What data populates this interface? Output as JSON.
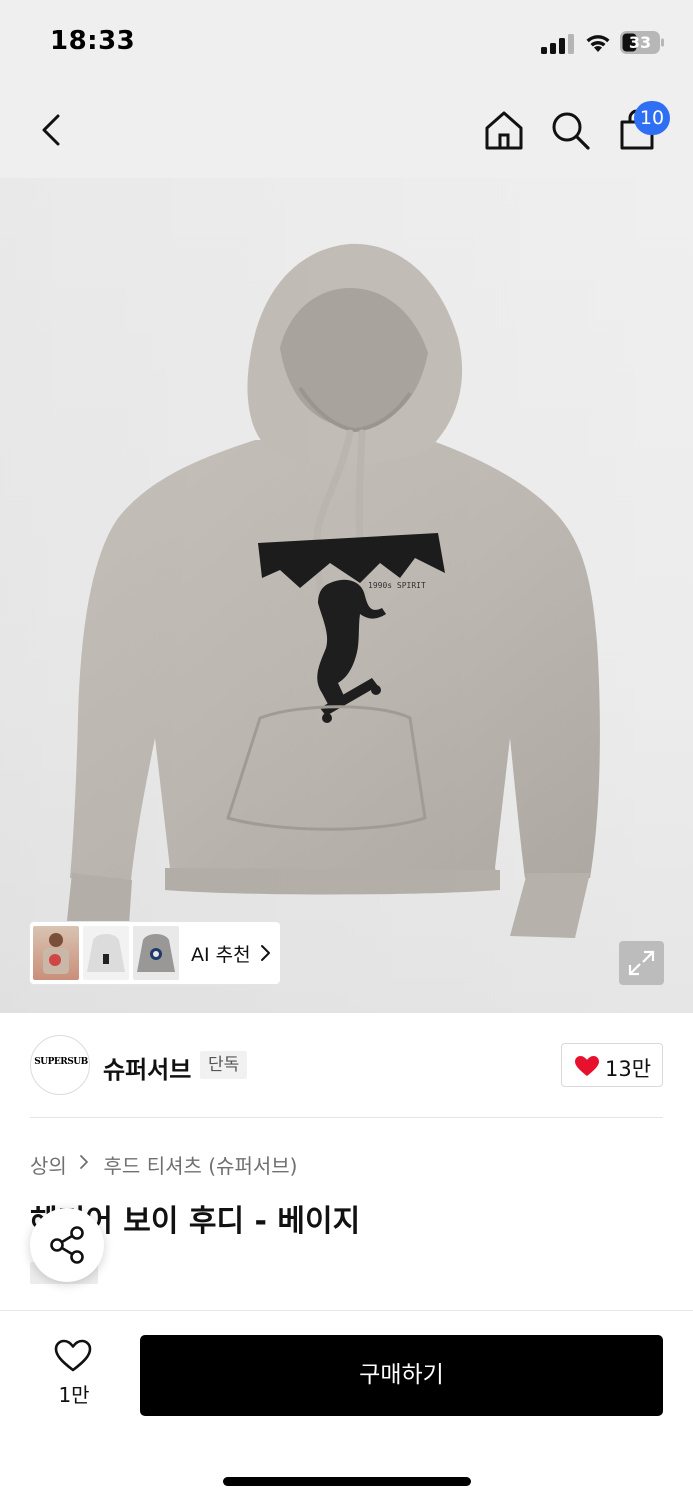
{
  "status_bar": {
    "time": "18:33",
    "battery": "33",
    "icons": [
      "cellular-signal-icon",
      "wifi-icon",
      "battery-icon"
    ]
  },
  "top_nav": {
    "icons": [
      "back-chevron-icon",
      "home-icon",
      "search-icon",
      "shopping-bag-icon"
    ],
    "cart_count": "10",
    "badge_color": "#2f6ff4"
  },
  "hero": {
    "image": "beige hoodie with black skater graphic",
    "graphic_subtext": "1990s SPIRIT",
    "ai_recommend_label": "AI 추천",
    "expand_icon": "expand-arrows-icon"
  },
  "brand": {
    "logo_text": "SUPERSUB",
    "name": "슈퍼서브",
    "tag": "단독",
    "like_count": "13만",
    "heart_color": "#e8112d"
  },
  "product": {
    "breadcrumb": [
      "상의",
      "후드 티셔츠 (슈퍼서브)"
    ],
    "title": "헤리어 보이 후디 - 베이지",
    "share_icon": "share-icon"
  },
  "bottom_bar": {
    "wishlist_count": "1만",
    "buy_label": "구매하기"
  }
}
